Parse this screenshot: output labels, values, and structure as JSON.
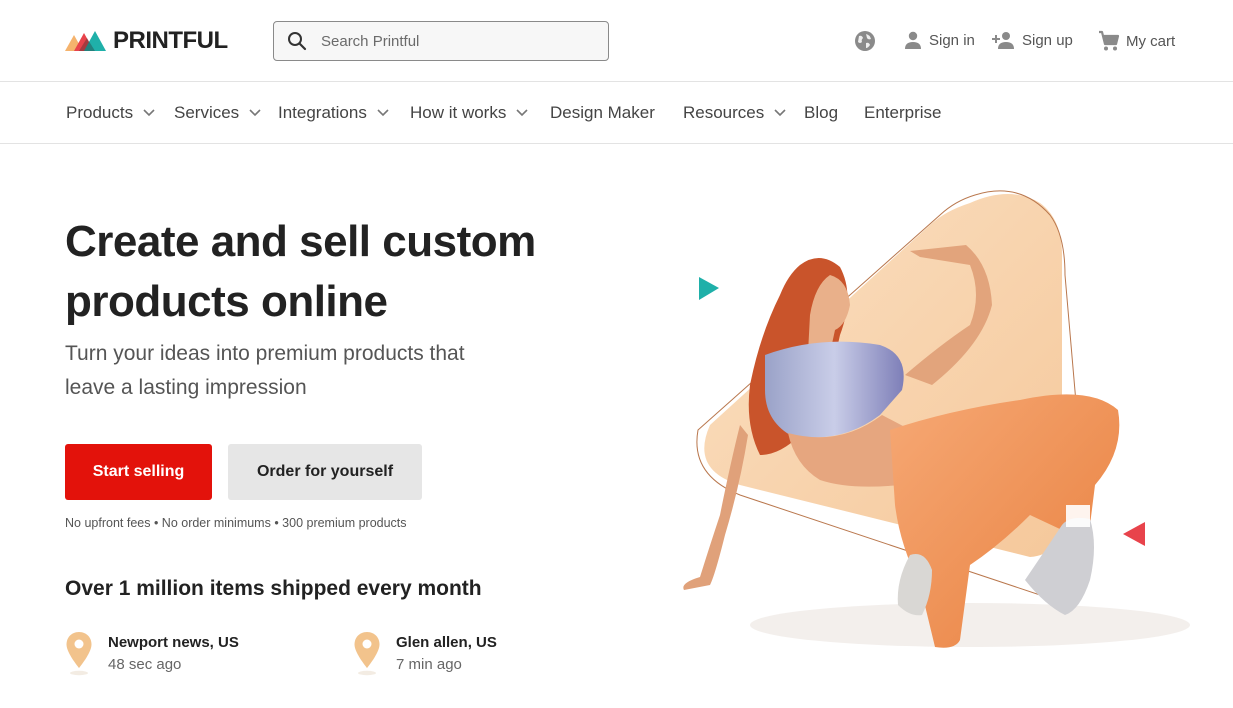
{
  "header": {
    "logo_text": "PRINTFUL",
    "search_placeholder": "Search Printful",
    "signin_label": "Sign in",
    "signup_label": "Sign up",
    "cart_label": "My cart"
  },
  "nav": {
    "items": [
      {
        "label": "Products",
        "dropdown": true
      },
      {
        "label": "Services",
        "dropdown": true
      },
      {
        "label": "Integrations",
        "dropdown": true
      },
      {
        "label": "How it works",
        "dropdown": true
      },
      {
        "label": "Design Maker",
        "dropdown": false
      },
      {
        "label": "Resources",
        "dropdown": true
      },
      {
        "label": "Blog",
        "dropdown": false
      },
      {
        "label": "Enterprise",
        "dropdown": false
      }
    ]
  },
  "hero": {
    "title_line1": "Create and sell custom",
    "title_line2": "products online",
    "subtitle_line1": "Turn your ideas into premium products that",
    "subtitle_line2": "leave a lasting impression",
    "primary_button": "Start selling",
    "secondary_button": "Order for yourself",
    "fine_print": "No upfront fees • No order minimums • 300 premium products"
  },
  "shipped": {
    "title": "Over 1 million items shipped every month",
    "items": [
      {
        "location": "Newport news, US",
        "time": "48 sec ago"
      },
      {
        "location": "Glen allen, US",
        "time": "7 min ago"
      }
    ]
  },
  "colors": {
    "brand_red": "#e3120b",
    "pin_orange": "#f2c38c",
    "accent_teal": "#1fb0a9",
    "accent_red": "#e8434b",
    "peach": "#f8d2aa"
  },
  "icons": [
    "printful-logo-icon",
    "search-icon",
    "globe-icon",
    "person-icon",
    "person-add-icon",
    "cart-icon",
    "chevron-down-icon",
    "location-pin-icon",
    "play-triangle-icon"
  ]
}
